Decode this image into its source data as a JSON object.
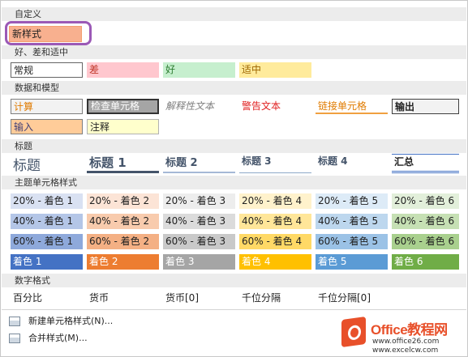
{
  "sections": {
    "custom": "自定义",
    "good_bad": "好、差和适中",
    "data_model": "数据和模型",
    "titles": "标题",
    "themed": "主题单元格样式",
    "number": "数字格式"
  },
  "custom": {
    "new_style": "新样式"
  },
  "good_bad": {
    "normal": "常规",
    "bad": "差",
    "good": "好",
    "neutral": "适中"
  },
  "data_model": {
    "calc": "计算",
    "check": "检查单元格",
    "explanatory": "解释性文本",
    "warning": "警告文本",
    "linked": "链接单元格",
    "output": "输出",
    "input": "输入",
    "note": "注释"
  },
  "titles": {
    "title": "标题",
    "h1": "标题 1",
    "h2": "标题 2",
    "h3": "标题 3",
    "h4": "标题 4",
    "total": "汇总"
  },
  "themed": {
    "r20": [
      "20% - 着色 1",
      "20% - 着色 2",
      "20% - 着色 3",
      "20% - 着色 4",
      "20% - 着色 5",
      "20% - 着色 6"
    ],
    "r40": [
      "40% - 着色 1",
      "40% - 着色 2",
      "40% - 着色 3",
      "40% - 着色 4",
      "40% - 着色 5",
      "40% - 着色 6"
    ],
    "r60": [
      "60% - 着色 1",
      "60% - 着色 2",
      "60% - 着色 3",
      "60% - 着色 4",
      "60% - 着色 5",
      "60% - 着色 6"
    ],
    "accent": [
      "着色 1",
      "着色 2",
      "着色 3",
      "着色 4",
      "着色 5",
      "着色 6"
    ]
  },
  "number": {
    "percent": "百分比",
    "currency": "货币",
    "currency0": "货币[0]",
    "comma": "千位分隔",
    "comma0": "千位分隔[0]"
  },
  "menu": {
    "new_cell_style": "新建单元格样式(N)...",
    "merge_styles": "合并样式(M)..."
  },
  "watermark": {
    "brand": "Office教程网",
    "url": "www.office26.com",
    "url2": "www.excelcw.com"
  },
  "colors": {
    "accent1": "#4472c4",
    "accent2": "#ed7d31",
    "accent3": "#a5a5a5",
    "accent4": "#ffc000",
    "accent5": "#5b9bd5",
    "accent6": "#70ad47",
    "highlight_ring": "#9b59b6"
  }
}
